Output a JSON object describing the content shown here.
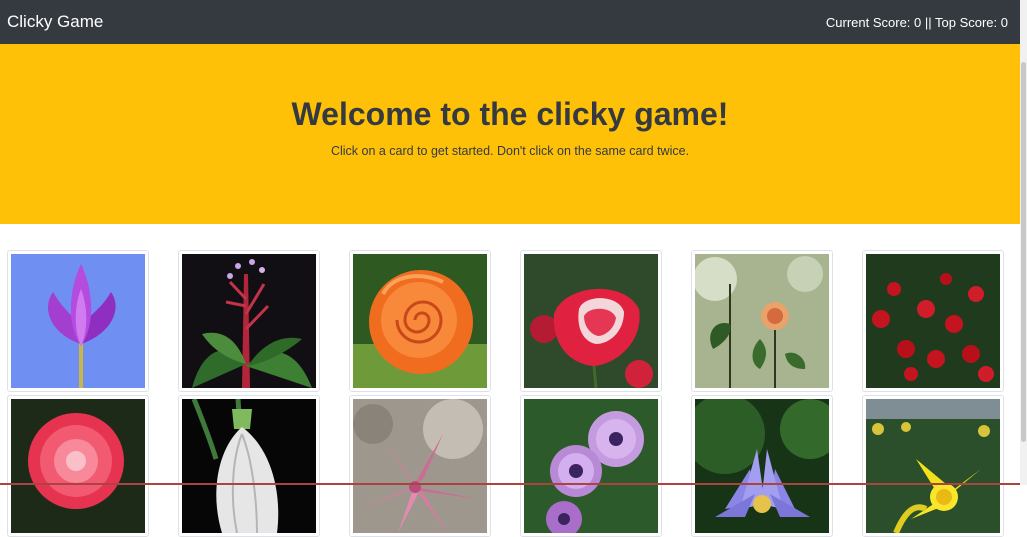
{
  "navbar": {
    "brand": "Clicky Game",
    "score_text": "Current Score: 0 || Top Score: 0"
  },
  "jumbotron": {
    "title": "Welcome to the clicky game!",
    "subtitle": "Click on a card to get started. Don't click on the same card twice."
  },
  "colors": {
    "navbar": "#343a40",
    "jumbotron": "#ffc107"
  },
  "cards": [
    {
      "subject": "purple tulip"
    },
    {
      "subject": "red bromeliad"
    },
    {
      "subject": "orange rose"
    },
    {
      "subject": "pink-red rose"
    },
    {
      "subject": "wild flowers"
    },
    {
      "subject": "red rose bush"
    },
    {
      "subject": "pink daisy"
    },
    {
      "subject": "white snowdrop"
    },
    {
      "subject": "pink lily"
    },
    {
      "subject": "purple osteospermum"
    },
    {
      "subject": "purple water lily"
    },
    {
      "subject": "yellow daffodil"
    }
  ]
}
